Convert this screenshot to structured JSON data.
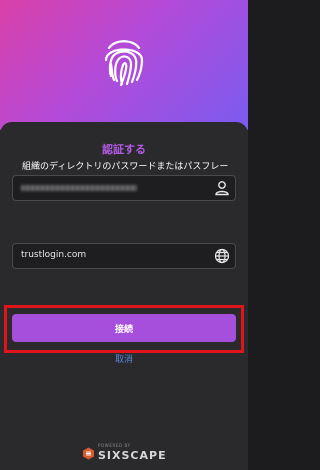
{
  "header": {
    "icon": "fingerprint-icon",
    "gradient": [
      "#d940a8",
      "#b44ad8",
      "#7a5cf0"
    ]
  },
  "dialog": {
    "title": "認証する",
    "instruction": "組織のディレクトリのパスワードまたはパスフレーズを入力してください",
    "username": {
      "value": "",
      "icon": "user-icon",
      "obscured": true
    },
    "domain": {
      "value": "trustlogin.com",
      "icon": "globe-icon"
    },
    "connect_label": "接続",
    "cancel_label": "取消"
  },
  "footer": {
    "powered_by": "POWERED BY",
    "brand": "SIXSCAPE"
  },
  "colors": {
    "accent": "#a64fdc",
    "title": "#b45be6",
    "link": "#5a86e0",
    "highlight": "#e0141b"
  }
}
